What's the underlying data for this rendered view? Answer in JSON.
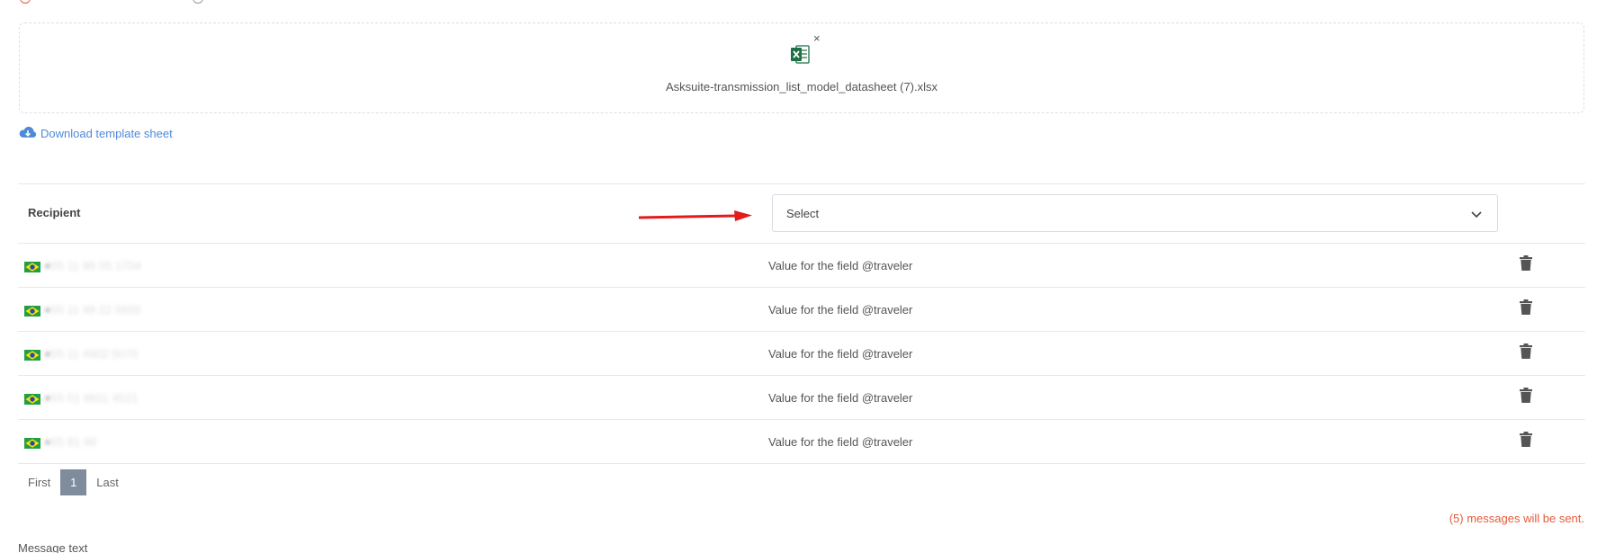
{
  "upload": {
    "file_name": "Asksuite-transmission_list_model_datasheet (7).xlsx",
    "file_icon": "excel-file-icon",
    "remove_symbol": "×"
  },
  "download_template": {
    "label": "Download template sheet",
    "icon": "cloud-download-icon"
  },
  "table": {
    "recipient_header": "Recipient",
    "select": {
      "placeholder": "Select"
    },
    "rows": [
      {
        "flag": "brazil-flag-icon",
        "phone_prefix": "+",
        "phone_rest": "55 11 99 55 1704",
        "value": "Value for the field @traveler"
      },
      {
        "flag": "brazil-flag-icon",
        "phone_prefix": "+",
        "phone_rest": "55 11 99 22 5655",
        "value": "Value for the field @traveler"
      },
      {
        "flag": "brazil-flag-icon",
        "phone_prefix": "+",
        "phone_rest": "55 11 4902 5070",
        "value": "Value for the field @traveler"
      },
      {
        "flag": "brazil-flag-icon",
        "phone_prefix": "+",
        "phone_rest": "55 51 9911 4521",
        "value": "Value for the field @traveler"
      },
      {
        "flag": "brazil-flag-icon",
        "phone_prefix": "+",
        "phone_rest": "55 81 99",
        "value": "Value for the field @traveler"
      }
    ]
  },
  "pagination": {
    "first": "First",
    "current": "1",
    "last": "Last"
  },
  "messages_notice": "(5) messages will be sent.",
  "message_text_label": "Message text",
  "colors": {
    "accent_red": "#e55b3c",
    "link_blue": "#4f8ad9",
    "excel_green": "#1e7145"
  }
}
